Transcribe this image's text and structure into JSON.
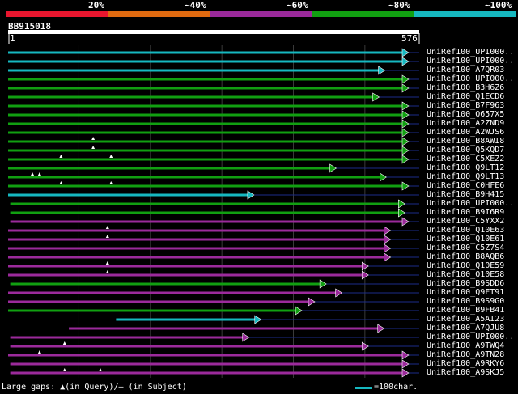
{
  "identity_legend": [
    {
      "label": "20%",
      "color": "#e8162e"
    },
    {
      "label": "~40%",
      "color": "#e06a10"
    },
    {
      "label": "~60%",
      "color": "#9b2a9b"
    },
    {
      "label": "~80%",
      "color": "#11a011"
    },
    {
      "label": "~100%",
      "color": "#16b8c0"
    }
  ],
  "query": {
    "name": "BB915018",
    "start_label": "1",
    "end_label": "576"
  },
  "footer": {
    "gap_legend": "Large gaps: ▲(in Query)/– (in Subject)",
    "scale_legend": "=100char."
  },
  "chart_data": {
    "type": "alignment",
    "query_length": 576,
    "gridlines": [
      100,
      200,
      300,
      400,
      500
    ],
    "hits": [
      {
        "name": "UniRef100_UPI000..",
        "start": 1,
        "end": 576,
        "identity_class": "~100%",
        "color": "#16b8c0",
        "query_gaps": []
      },
      {
        "name": "UniRef100_UPI000..",
        "start": 1,
        "end": 576,
        "identity_class": "~100%",
        "color": "#16b8c0",
        "query_gaps": []
      },
      {
        "name": "UniRef100_A7QR03",
        "start": 1,
        "end": 528,
        "identity_class": "~100%",
        "color": "#16b8c0",
        "query_gaps": []
      },
      {
        "name": "UniRef100_UPI000..",
        "start": 1,
        "end": 576,
        "identity_class": "~80%",
        "color": "#11a011",
        "query_gaps": []
      },
      {
        "name": "UniRef100_B3H6Z6",
        "start": 1,
        "end": 620,
        "identity_class": "~80%",
        "color": "#11a011",
        "query_gaps": []
      },
      {
        "name": "UniRef100_Q1ECD6",
        "start": 1,
        "end": 520,
        "identity_class": "~80%",
        "color": "#11a011",
        "query_gaps": []
      },
      {
        "name": "UniRef100_B7F963",
        "start": 1,
        "end": 580,
        "identity_class": "~80%",
        "color": "#11a011",
        "query_gaps": []
      },
      {
        "name": "UniRef100_Q657X5",
        "start": 1,
        "end": 580,
        "identity_class": "~80%",
        "color": "#11a011",
        "query_gaps": []
      },
      {
        "name": "UniRef100_A2ZND9",
        "start": 1,
        "end": 580,
        "identity_class": "~80%",
        "color": "#11a011",
        "query_gaps": []
      },
      {
        "name": "UniRef100_A2WJS6",
        "start": 1,
        "end": 580,
        "identity_class": "~80%",
        "color": "#11a011",
        "query_gaps": []
      },
      {
        "name": "UniRef100_B8AWI8",
        "start": 1,
        "end": 580,
        "identity_class": "~80%",
        "color": "#11a011",
        "query_gaps": [
          120
        ]
      },
      {
        "name": "UniRef100_Q5KQD7",
        "start": 1,
        "end": 580,
        "identity_class": "~80%",
        "color": "#11a011",
        "query_gaps": [
          120
        ]
      },
      {
        "name": "UniRef100_C5XEZ2",
        "start": 1,
        "end": 580,
        "identity_class": "~80%",
        "color": "#11a011",
        "query_gaps": [
          75,
          145
        ]
      },
      {
        "name": "UniRef100_Q9LT12",
        "start": 1,
        "end": 460,
        "identity_class": "~80%",
        "color": "#11a011",
        "query_gaps": []
      },
      {
        "name": "UniRef100_Q9LT13",
        "start": 1,
        "end": 530,
        "identity_class": "~80%",
        "color": "#11a011",
        "query_gaps": [
          35,
          45
        ]
      },
      {
        "name": "UniRef100_C0HFE6",
        "start": 1,
        "end": 580,
        "identity_class": "~80%",
        "color": "#11a011",
        "query_gaps": [
          75,
          145
        ]
      },
      {
        "name": "UniRef100_B9H415",
        "start": 1,
        "end": 345,
        "identity_class": "~100%",
        "color": "#16b8c0",
        "query_gaps": []
      },
      {
        "name": "UniRef100_UPI000..",
        "start": 4,
        "end": 556,
        "identity_class": "~80%",
        "color": "#11a011",
        "query_gaps": []
      },
      {
        "name": "UniRef100_B9I6R9",
        "start": 4,
        "end": 556,
        "identity_class": "~80%",
        "color": "#11a011",
        "query_gaps": []
      },
      {
        "name": "UniRef100_C5YXX2",
        "start": 4,
        "end": 580,
        "identity_class": "~60%",
        "color": "#9b2a9b",
        "query_gaps": []
      },
      {
        "name": "UniRef100_Q10E63",
        "start": 1,
        "end": 536,
        "identity_class": "~60%",
        "color": "#9b2a9b",
        "query_gaps": [
          140
        ]
      },
      {
        "name": "UniRef100_Q10E61",
        "start": 1,
        "end": 536,
        "identity_class": "~60%",
        "color": "#9b2a9b",
        "query_gaps": [
          140
        ]
      },
      {
        "name": "UniRef100_C5Z7S4",
        "start": 1,
        "end": 536,
        "identity_class": "~60%",
        "color": "#9b2a9b",
        "query_gaps": []
      },
      {
        "name": "UniRef100_B8AQB6",
        "start": 1,
        "end": 536,
        "identity_class": "~60%",
        "color": "#9b2a9b",
        "query_gaps": []
      },
      {
        "name": "UniRef100_Q10E59",
        "start": 1,
        "end": 505,
        "identity_class": "~60%",
        "color": "#9b2a9b",
        "query_gaps": [
          140
        ]
      },
      {
        "name": "UniRef100_Q10E58",
        "start": 1,
        "end": 505,
        "identity_class": "~60%",
        "color": "#9b2a9b",
        "query_gaps": [
          140
        ]
      },
      {
        "name": "UniRef100_B9SDD6",
        "start": 4,
        "end": 446,
        "identity_class": "~80%",
        "color": "#11a011",
        "query_gaps": []
      },
      {
        "name": "UniRef100_Q9FT91",
        "start": 1,
        "end": 468,
        "identity_class": "~60%",
        "color": "#9b2a9b",
        "query_gaps": []
      },
      {
        "name": "UniRef100_B9S9G0",
        "start": 1,
        "end": 430,
        "identity_class": "~60%",
        "color": "#9b2a9b",
        "query_gaps": []
      },
      {
        "name": "UniRef100_B9FB41",
        "start": 1,
        "end": 412,
        "identity_class": "~80%",
        "color": "#11a011",
        "query_gaps": []
      },
      {
        "name": "UniRef100_A5AI23",
        "start": 152,
        "end": 355,
        "identity_class": "~100%",
        "color": "#16b8c0",
        "query_gaps": []
      },
      {
        "name": "UniRef100_A7QJU8",
        "start": 86,
        "end": 527,
        "identity_class": "~60%",
        "color": "#9b2a9b",
        "query_gaps": []
      },
      {
        "name": "UniRef100_UPI000..",
        "start": 4,
        "end": 338,
        "identity_class": "~60%",
        "color": "#9b2a9b",
        "query_gaps": []
      },
      {
        "name": "UniRef100_A9TWQ4",
        "start": 4,
        "end": 505,
        "identity_class": "~60%",
        "color": "#9b2a9b",
        "query_gaps": [
          80
        ]
      },
      {
        "name": "UniRef100_A9TN28",
        "start": 1,
        "end": 565,
        "identity_class": "~60%",
        "color": "#9b2a9b",
        "query_gaps": [
          45
        ]
      },
      {
        "name": "UniRef100_A9RKY6",
        "start": 4,
        "end": 565,
        "identity_class": "~60%",
        "color": "#9b2a9b",
        "query_gaps": []
      },
      {
        "name": "UniRef100_A9SKJ5",
        "start": 4,
        "end": 565,
        "identity_class": "~60%",
        "color": "#9b2a9b",
        "query_gaps": [
          80,
          130
        ]
      }
    ]
  }
}
